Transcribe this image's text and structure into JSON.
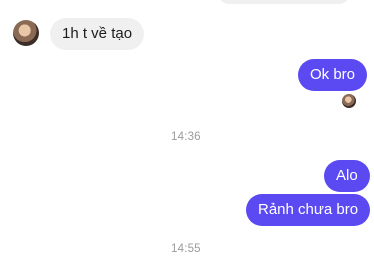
{
  "messages": [
    {
      "direction": "incoming",
      "text": "1h t về tạo"
    },
    {
      "direction": "outgoing",
      "text": "Ok bro"
    },
    {
      "direction": "outgoing",
      "text": "Alo"
    },
    {
      "direction": "outgoing",
      "text": "Rảnh chưa bro"
    }
  ],
  "timestamps": [
    "14:36",
    "14:55"
  ],
  "colors": {
    "outgoing_bubble": "#5b4af2",
    "incoming_bubble": "#f0f0f0",
    "timestamp_text": "#9a9aa0"
  },
  "icons": {
    "contact_avatar": "avatar-icon",
    "read_receipt": "read-receipt-avatar-icon"
  }
}
